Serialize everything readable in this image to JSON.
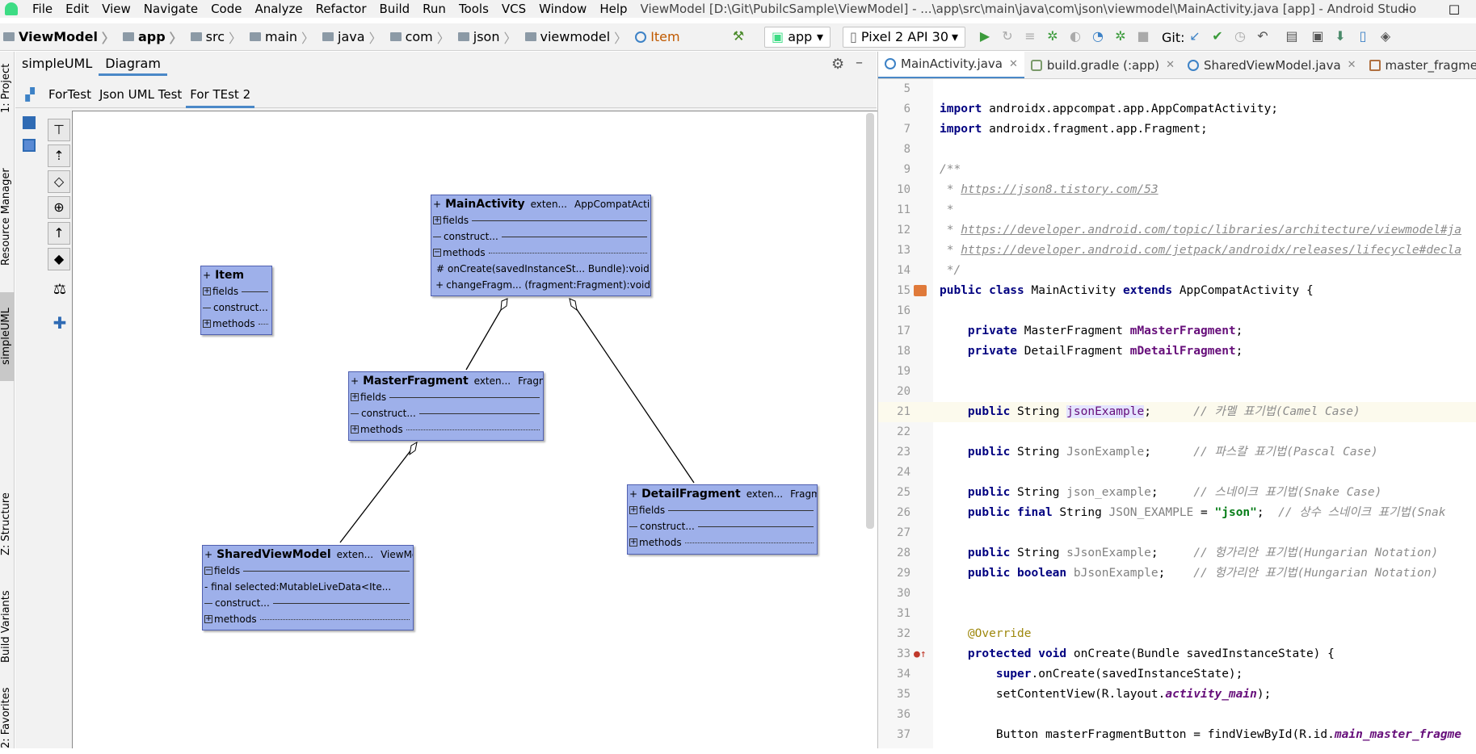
{
  "menubar": {
    "items": [
      "File",
      "Edit",
      "View",
      "Navigate",
      "Code",
      "Analyze",
      "Refactor",
      "Build",
      "Run",
      "Tools",
      "VCS",
      "Window",
      "Help"
    ],
    "title": "ViewModel [D:\\Git\\PubilcSample\\ViewModel] - ...\\app\\src\\main\\java\\com\\json\\viewmodel\\MainActivity.java [app] - Android Studio"
  },
  "breadcrumb": [
    "ViewModel",
    "app",
    "src",
    "main",
    "java",
    "com",
    "json",
    "viewmodel",
    "Item"
  ],
  "toolbar": {
    "config": "app",
    "device": "Pixel 2 API 30",
    "git_label": "Git:"
  },
  "side_tabs": [
    "1: Project",
    "Resource Manager",
    "simpleUML",
    "Z: Structure",
    "Build Variants",
    "2: Favorites"
  ],
  "uml_tabs": [
    "simpleUML",
    "Diagram"
  ],
  "diagram_tabs": [
    "ForTest",
    "Json UML Test",
    "For TEst 2"
  ],
  "uml": {
    "main_activity": {
      "name": "MainActivity",
      "ext": "exten...",
      "parent": "AppCompatActi...",
      "fields": "fields",
      "construct": "construct...",
      "methods": "methods",
      "m1_mod": "#",
      "m1": "onCreate(savedInstanceSt...  Bundle):void",
      "m2_mod": "+",
      "m2": "changeFragm...  (fragment:Fragment):void"
    },
    "item": {
      "name": "Item",
      "fields": "fields",
      "construct": "construct...",
      "methods": "methods"
    },
    "master": {
      "name": "MasterFragment",
      "ext": "exten...",
      "parent": "Fragment",
      "fields": "fields",
      "construct": "construct...",
      "methods": "methods"
    },
    "detail": {
      "name": "DetailFragment",
      "ext": "exten...",
      "parent": "Fragment",
      "fields": "fields",
      "construct": "construct...",
      "methods": "methods"
    },
    "shared": {
      "name": "SharedViewModel",
      "ext": "exten...",
      "parent": "ViewModel",
      "fields": "fields",
      "field1": "- final   selected:MutableLiveData<Ite...",
      "construct": "construct...",
      "methods": "methods"
    }
  },
  "editor_tabs": [
    "MainActivity.java",
    "build.gradle (:app)",
    "SharedViewModel.java",
    "master_fragme"
  ],
  "code": {
    "l5": "",
    "l6a": "import",
    "l6b": " androidx.appcompat.app.AppCompatActivity;",
    "l7a": "import",
    "l7b": " androidx.fragment.app.Fragment;",
    "l9": "/**",
    "l10a": " * ",
    "l10b": "https://json8.tistory.com/53",
    "l11": " *",
    "l12a": " * ",
    "l12b": "https://developer.android.com/topic/libraries/architecture/viewmodel#ja",
    "l13a": " * ",
    "l13b": "https://developer.android.com/jetpack/androidx/releases/lifecycle#decla",
    "l14": " */",
    "l15a": "public class",
    "l15b": " MainActivity ",
    "l15c": "extends",
    "l15d": " AppCompatActivity {",
    "l17a": "    private",
    "l17b": " MasterFragment ",
    "l17c": "mMasterFragment",
    "l17d": ";",
    "l18a": "    private",
    "l18b": " DetailFragment ",
    "l18c": "mDetailFragment",
    "l18d": ";",
    "l21a": "    public",
    "l21b": " String ",
    "l21c": "jsonExample",
    "l21d": ";      ",
    "l21e": "// 카멜 표기법(Camel Case)",
    "l23a": "    public",
    "l23b": " String ",
    "l23c": "JsonExample",
    "l23d": ";      ",
    "l23e": "// 파스칼 표기법(Pascal Case)",
    "l25a": "    public",
    "l25b": " String ",
    "l25c": "json_example",
    "l25d": ";     ",
    "l25e": "// 스네이크 표기법(Snake Case)",
    "l26a": "    public final",
    "l26b": " String ",
    "l26c": "JSON_EXAMPLE",
    "l26d": " = ",
    "l26e": "\"json\"",
    "l26f": ";  ",
    "l26g": "// 상수 스네이크 표기법(Snak",
    "l28a": "    public",
    "l28b": " String ",
    "l28c": "sJsonExample",
    "l28d": ";     ",
    "l28e": "// 헝가리안 표기법(Hungarian Notation)",
    "l29a": "    public boolean",
    "l29b": " bJsonExample",
    "l29c": ";    ",
    "l29d": "// 헝가리안 표기법(Hungarian Notation)",
    "l32": "    @Override",
    "l33a": "    protected void",
    "l33b": " onCreate(Bundle savedInstanceState) {",
    "l34a": "        super",
    "l34b": ".onCreate(savedInstanceState);",
    "l35a": "        setContentView(R.layout.",
    "l35b": "activity_main",
    "l35c": ");",
    "l37a": "        Button masterFragmentButton = findViewById(R.id.",
    "l37b": "main_master_fragme"
  }
}
